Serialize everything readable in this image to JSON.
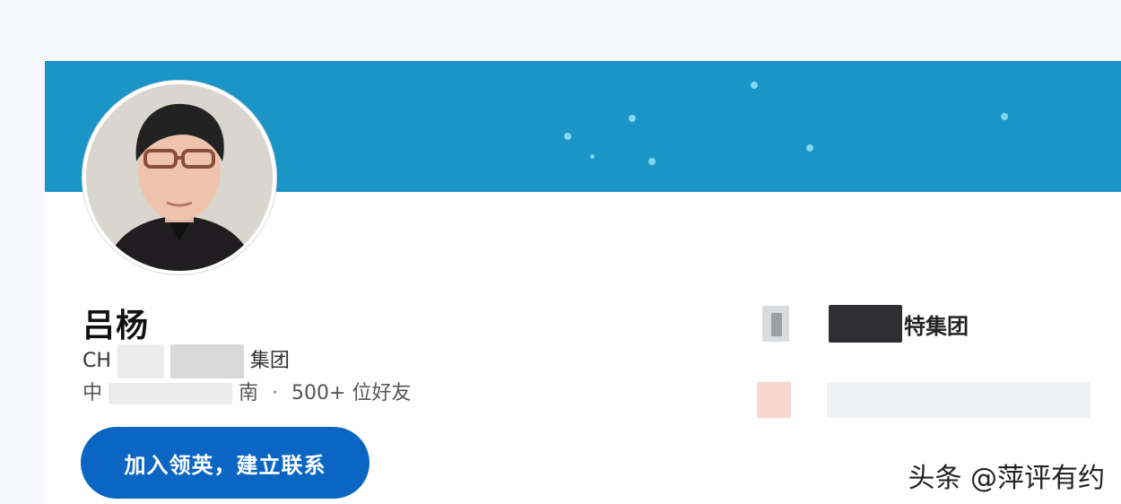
{
  "profile": {
    "name": "吕杨",
    "headline_prefix": "CH",
    "headline_suffix": "集团",
    "location_prefix": "中",
    "location_suffix": "南",
    "separator": "·",
    "connections": "500+ 位好友"
  },
  "actions": {
    "connect_label": "加入领英，建立联系"
  },
  "experience": {
    "company_suffix": "特集团"
  },
  "watermark": {
    "text": "头条 @萍评有约"
  },
  "colors": {
    "banner": "#1b95c6",
    "button": "#0a66c2"
  }
}
